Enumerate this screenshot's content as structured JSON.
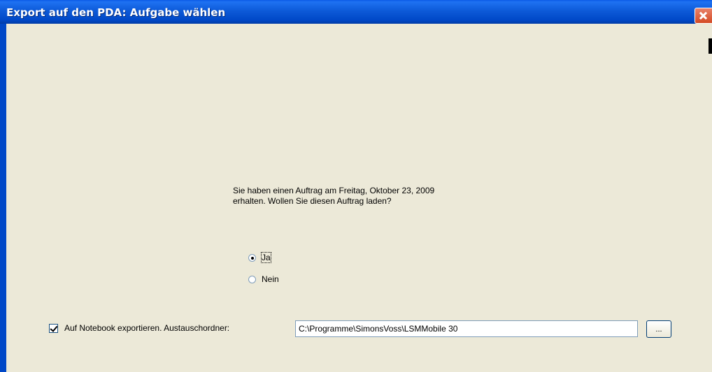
{
  "window": {
    "title": "Export auf den PDA: Aufgabe wählen"
  },
  "message": {
    "line1": "Sie haben einen Auftrag am Freitag, Oktober 23, 2009",
    "line2": "erhalten. Wollen Sie diesen Auftrag laden?"
  },
  "options": {
    "yes_label": "Ja",
    "no_label": "Nein",
    "selected": "Ja"
  },
  "export": {
    "checkbox_label": "Auf Notebook exportieren. Austauschordner:",
    "checked": true,
    "folder_path": "C:\\Programme\\SimonsVoss\\LSMMobile 30",
    "browse_label": "..."
  },
  "colors": {
    "titlebar": "#0048c7",
    "dialog_bg": "#ece9d8",
    "close_button": "#d44a24"
  }
}
